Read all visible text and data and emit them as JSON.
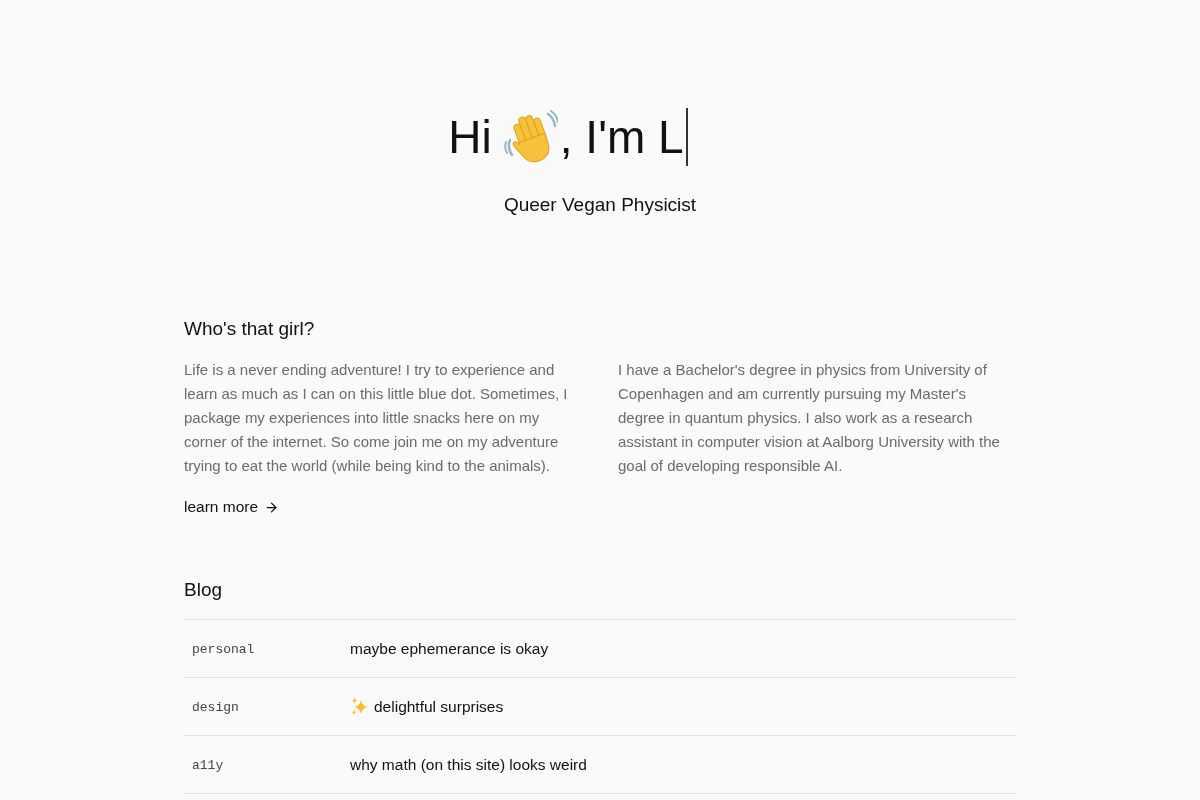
{
  "hero": {
    "greeting": "Hi",
    "name_text": ", I'm L",
    "cursor_visible": true,
    "subtitle": "Queer Vegan Physicist"
  },
  "about": {
    "heading": "Who's that girl?",
    "paragraphs": [
      "Life is a never ending adventure! I try to experience and learn as much as I can on this little blue dot. Sometimes, I package my experiences into little snacks here on my corner of the internet. So come join me on my adventure trying to eat the world (while being kind to the animals).",
      "I have a Bachelor's degree in physics from University of Copenhagen and am currently pursuing my Master's degree in quantum physics. I also work as a research assistant in computer vision at Aalborg University with the goal of developing responsible AI."
    ],
    "link": "learn more"
  },
  "blog": {
    "heading": "Blog",
    "posts": [
      {
        "tag": "personal",
        "title": "maybe ephemerance is okay",
        "has_icon": false
      },
      {
        "tag": "design",
        "title": "delightful surprises",
        "has_icon": true
      },
      {
        "tag": "a11y",
        "title": "why math (on this site) looks weird",
        "has_icon": false
      }
    ]
  }
}
